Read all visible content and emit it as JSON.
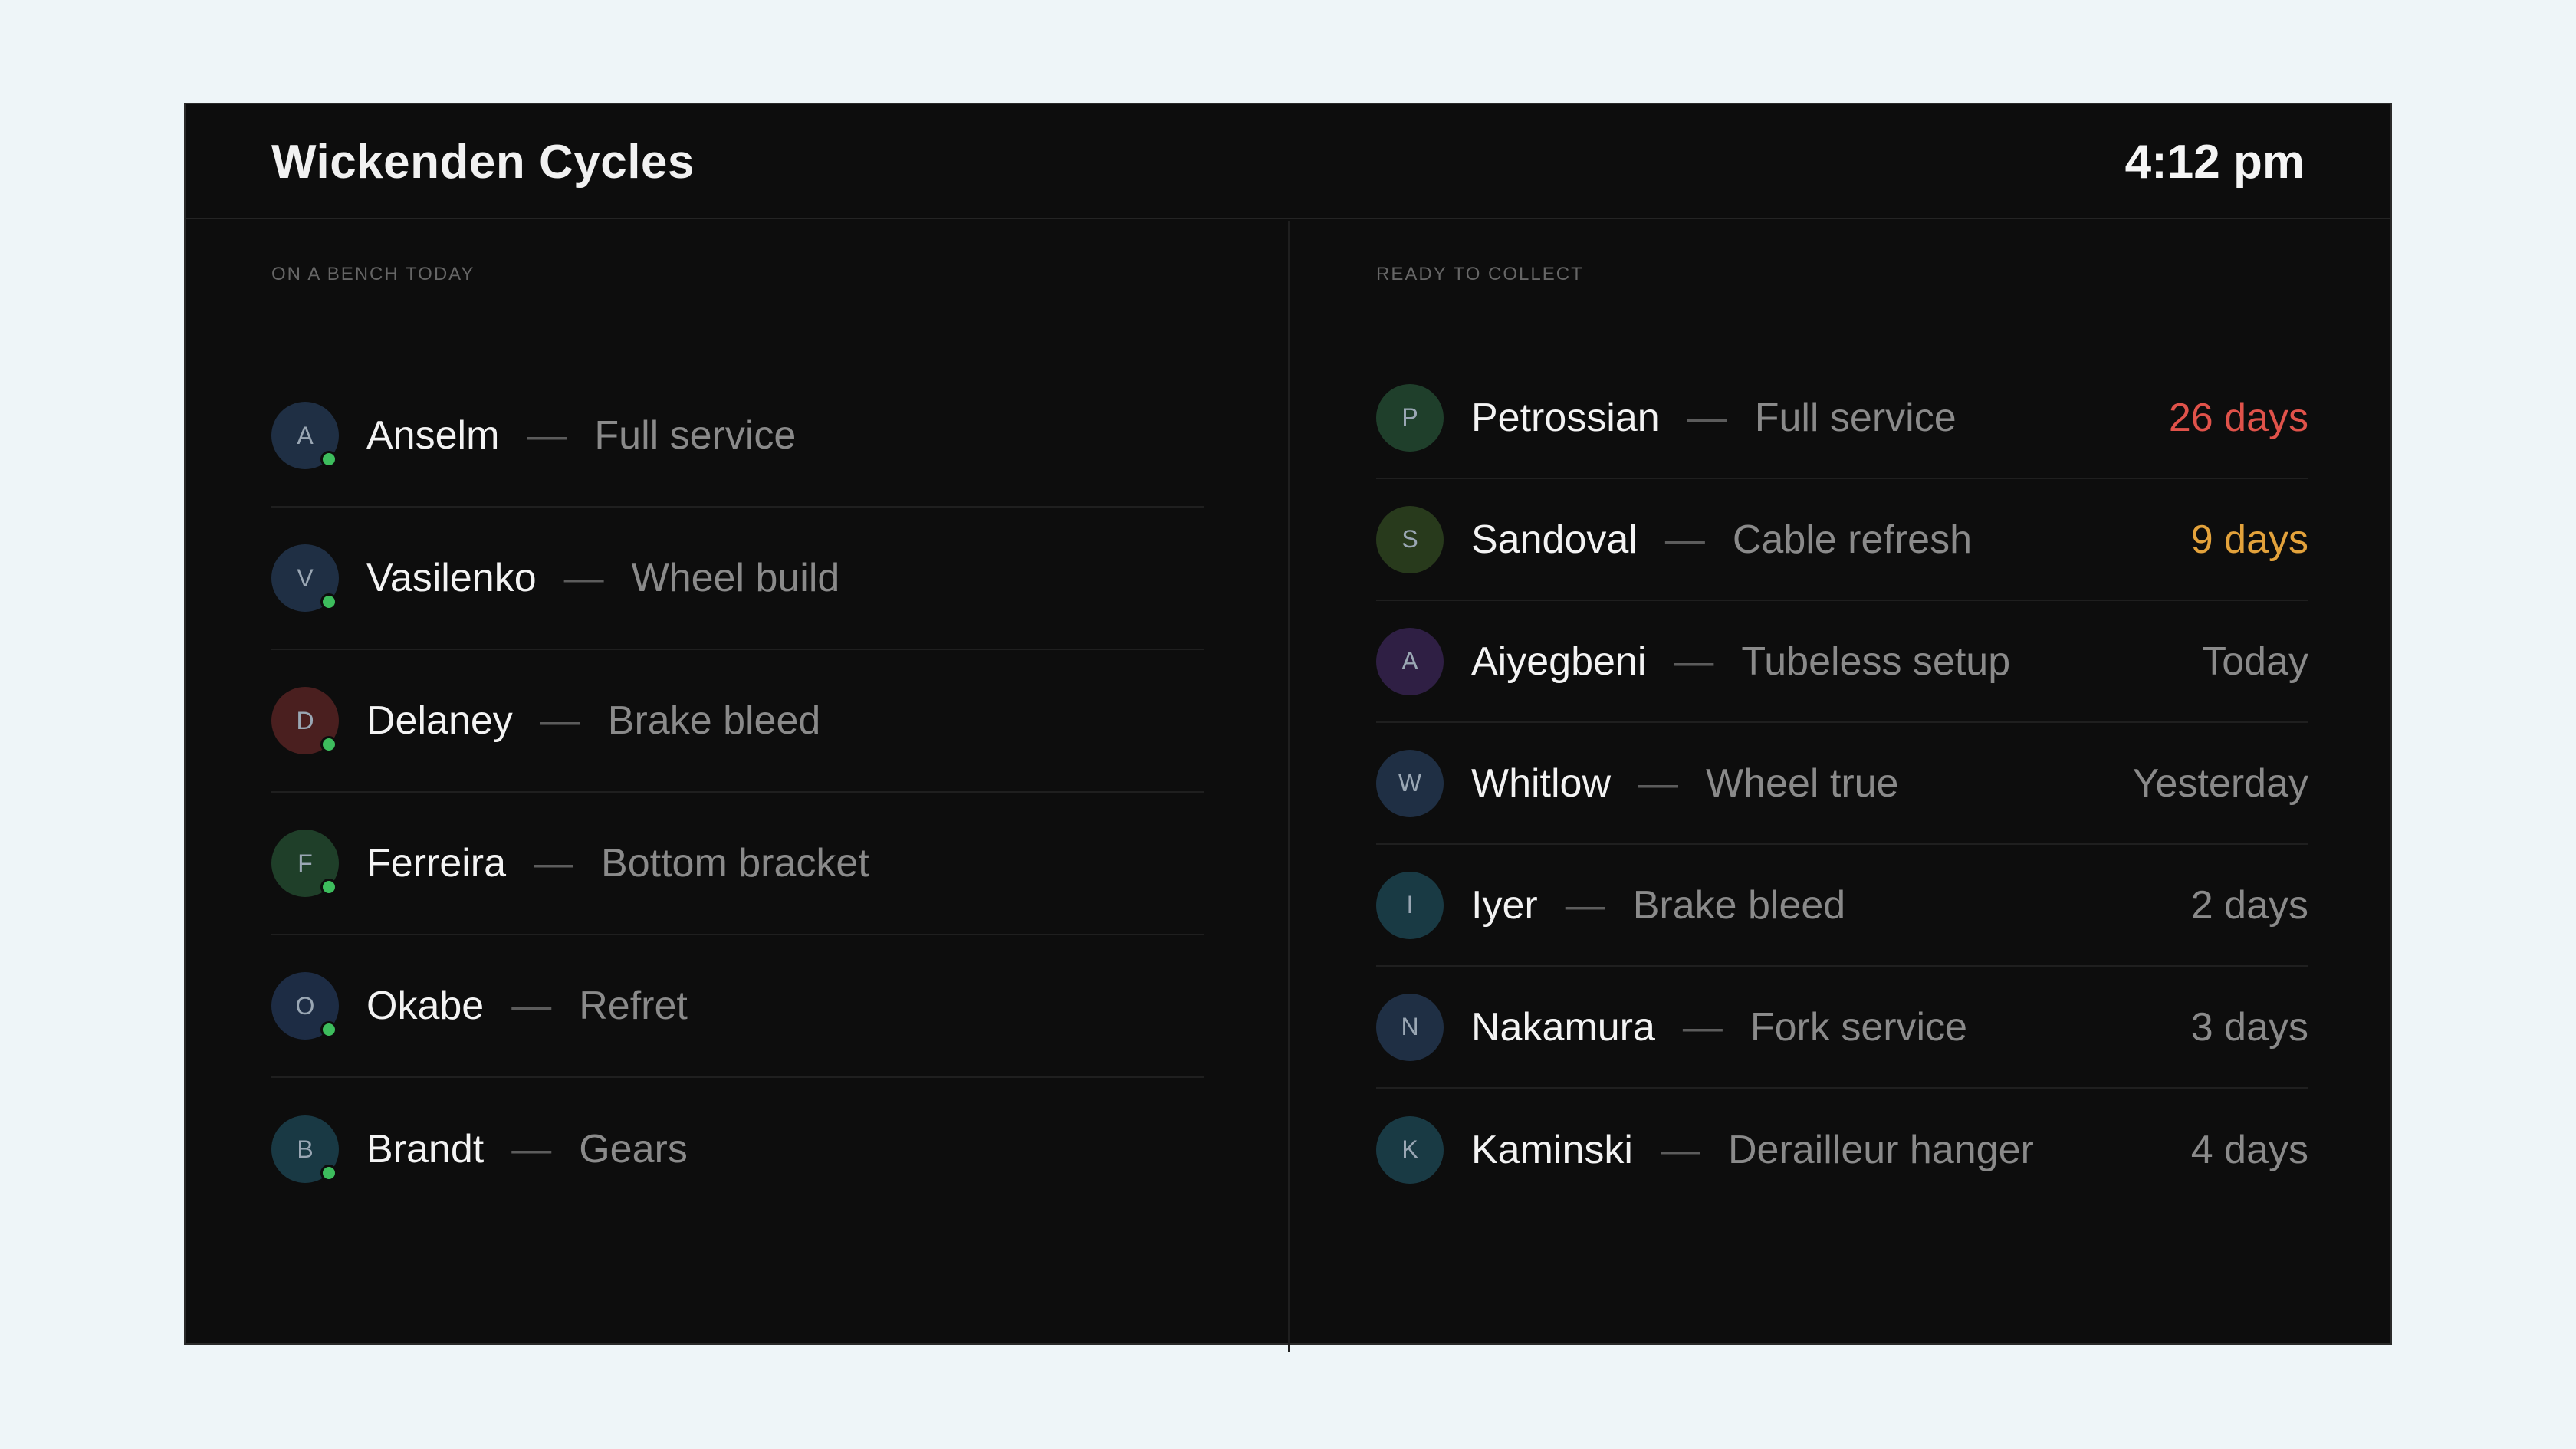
{
  "header": {
    "title": "Wickenden Cycles",
    "time": "4:12 pm"
  },
  "bench": {
    "label": "ON A BENCH TODAY",
    "items": [
      {
        "initial": "A",
        "name": "Anselm",
        "job": "Full service",
        "avatar_color": "#1f2f44"
      },
      {
        "initial": "V",
        "name": "Vasilenko",
        "job": "Wheel build",
        "avatar_color": "#1f2f44"
      },
      {
        "initial": "D",
        "name": "Delaney",
        "job": "Brake bleed",
        "avatar_color": "#4a1f1f"
      },
      {
        "initial": "F",
        "name": "Ferreira",
        "job": "Bottom bracket",
        "avatar_color": "#1f3f29"
      },
      {
        "initial": "O",
        "name": "Okabe",
        "job": "Refret",
        "avatar_color": "#1d2c44"
      },
      {
        "initial": "B",
        "name": "Brandt",
        "job": "Gears",
        "avatar_color": "#193944"
      }
    ]
  },
  "collect": {
    "label": "READY TO COLLECT",
    "items": [
      {
        "initial": "P",
        "name": "Petrossian",
        "job": "Full service",
        "age": "26 days",
        "age_color": "#e0524a",
        "avatar_color": "#1f3f2b"
      },
      {
        "initial": "S",
        "name": "Sandoval",
        "job": "Cable refresh",
        "age": "9 days",
        "age_color": "#e3a23b",
        "avatar_color": "#283a1c"
      },
      {
        "initial": "A",
        "name": "Aiyegbeni",
        "job": "Tubeless setup",
        "age": "Today",
        "age_color": "#8a8a8a",
        "avatar_color": "#2f1f44"
      },
      {
        "initial": "W",
        "name": "Whitlow",
        "job": "Wheel true",
        "age": "Yesterday",
        "age_color": "#8a8a8a",
        "avatar_color": "#1f2f44"
      },
      {
        "initial": "I",
        "name": "Iyer",
        "job": "Brake bleed",
        "age": "2 days",
        "age_color": "#8a8a8a",
        "avatar_color": "#193a44"
      },
      {
        "initial": "N",
        "name": "Nakamura",
        "job": "Fork service",
        "age": "3 days",
        "age_color": "#8a8a8a",
        "avatar_color": "#1f2f44"
      },
      {
        "initial": "K",
        "name": "Kaminski",
        "job": "Derailleur hanger",
        "age": "4 days",
        "age_color": "#8a8a8a",
        "avatar_color": "#193a44"
      }
    ]
  },
  "separator": "—",
  "colors": {
    "page_bg": "#eef5f8",
    "panel_bg": "#0d0d0d",
    "online_dot": "#3dbd5d"
  }
}
